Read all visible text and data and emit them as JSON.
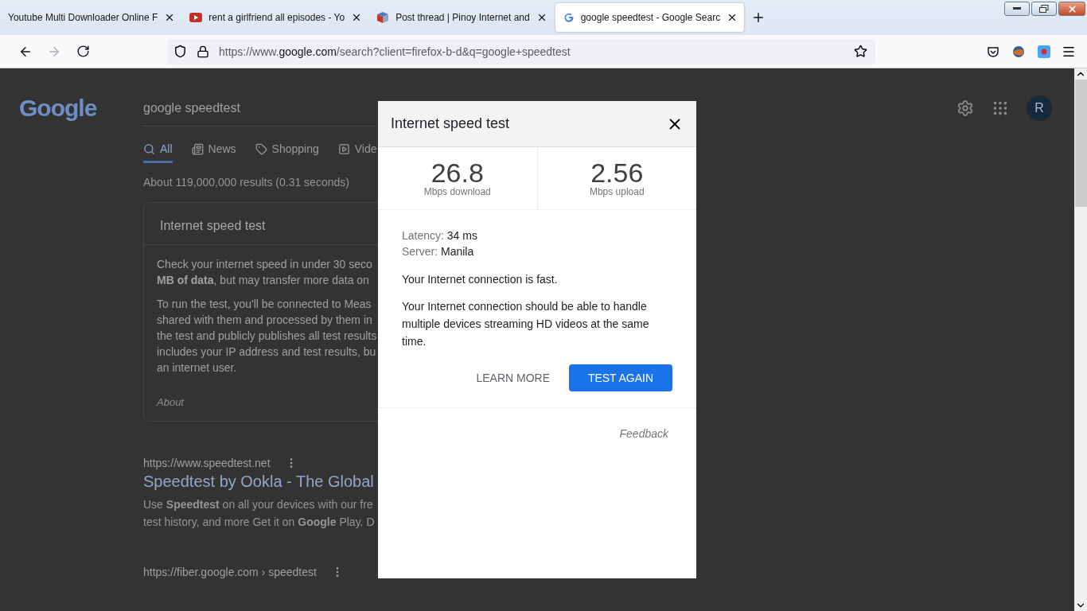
{
  "browser": {
    "tabs": [
      {
        "title": "Youtube Multi Downloader Online F",
        "kind": "plain",
        "selected": false
      },
      {
        "title": "rent a girlfriend all episodes - Yo",
        "kind": "video",
        "selected": false
      },
      {
        "title": "Post thread | Pinoy Internet and",
        "kind": "forum",
        "selected": false
      },
      {
        "title": "google speedtest - Google Searc",
        "kind": "search",
        "selected": true
      }
    ],
    "url": {
      "scheme": "https://www.",
      "domain": "google.com",
      "path": "/search?client=firefox-b-d&q=google+speedtest"
    }
  },
  "search_page": {
    "logo": "Google",
    "query": "google speedtest",
    "avatar": "R",
    "nav": [
      {
        "label": "All",
        "kind": "all",
        "selected": true
      },
      {
        "label": "News",
        "kind": "news",
        "selected": false
      },
      {
        "label": "Shopping",
        "kind": "shopping",
        "selected": false
      },
      {
        "label": "Vide",
        "kind": "videos",
        "selected": false
      }
    ],
    "result_stats": "About 119,000,000 results (0.31 seconds)",
    "card": {
      "title": "Internet speed test",
      "paragraphs": [
        [
          "Check your internet speed in under 30 seco",
          "**MB of data**, but may transfer more data on"
        ],
        [
          "To run the test, you'll be connected to Meas",
          "shared with them and processed by them in",
          "the test and publicly publishes all test results",
          "includes your IP address and test results, bu",
          "an internet user."
        ]
      ],
      "about": "About"
    },
    "results": [
      {
        "url": "https://www.speedtest.net",
        "title": "Speedtest by Ookla - The Global",
        "snippet": [
          "Use **Speedtest** on all your devices with our fre",
          "test history, and more Get it on **Google** Play. D"
        ]
      },
      {
        "url": "https://fiber.google.com › speedtest"
      }
    ]
  },
  "dialog": {
    "title": "Internet speed test",
    "stats": [
      {
        "value": "26.8",
        "unit": "Mbps download"
      },
      {
        "value": "2.56",
        "unit": "Mbps upload"
      }
    ],
    "details": [
      {
        "label": "Latency:",
        "value": "34 ms"
      },
      {
        "label": "Server:",
        "value": "Manila"
      }
    ],
    "verdict": "Your Internet connection is fast.",
    "description": "Your Internet connection should be able to handle multiple devices streaming HD videos at the same time.",
    "buttons": [
      {
        "label": "LEARN MORE",
        "kind": "text"
      },
      {
        "label": "TEST AGAIN",
        "kind": "primary"
      }
    ],
    "feedback": "Feedback"
  }
}
